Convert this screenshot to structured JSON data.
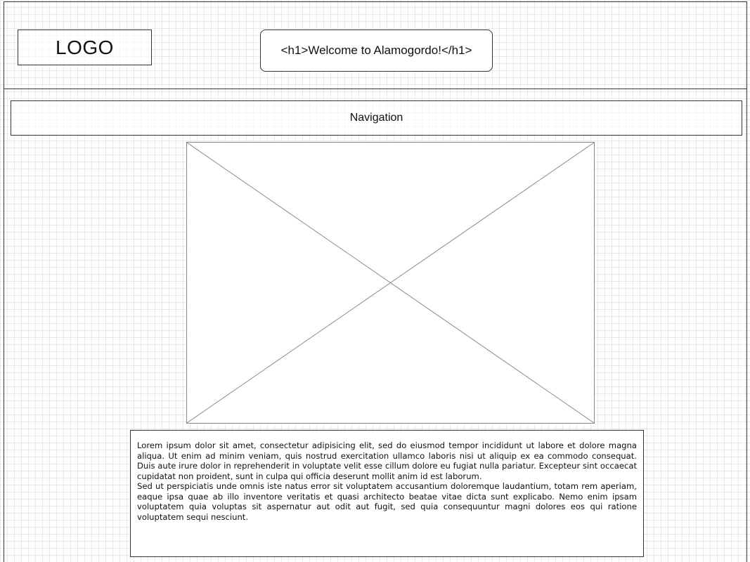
{
  "header": {
    "logo": "LOGO",
    "title": "<h1>Welcome to Alamogordo!</h1>"
  },
  "navigation": {
    "label": "Navigation"
  },
  "main": {
    "image": {
      "icon": "image-placeholder-icon"
    },
    "paragraphs": [
      "Lorem ipsum dolor sit amet, consectetur adipisicing elit, sed do eiusmod tempor incididunt ut labore et dolore magna aliqua. Ut enim ad minim veniam, quis nostrud exercitation ullamco laboris nisi ut aliquip ex ea commodo consequat. Duis aute irure dolor in reprehenderit in voluptate velit esse cillum dolore eu fugiat nulla pariatur. Excepteur sint occaecat cupidatat non proident, sunt in culpa qui officia deserunt mollit anim id est laborum.",
      "Sed ut perspiciatis unde omnis iste natus error sit voluptatem accusantium doloremque laudantium, totam rem aperiam, eaque ipsa quae ab illo inventore veritatis et quasi architecto beatae vitae dicta sunt explicabo. Nemo enim ipsam voluptatem quia voluptas sit aspernatur aut odit aut fugit, sed quia consequuntur magni dolores eos qui ratione voluptatem sequi nesciunt."
    ]
  }
}
